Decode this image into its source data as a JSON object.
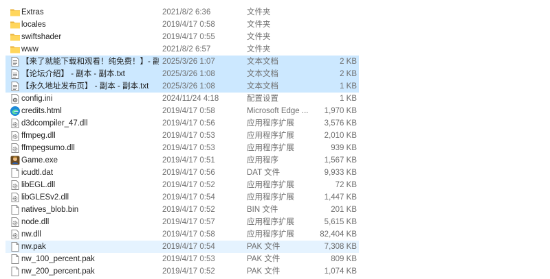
{
  "files": [
    {
      "name": "Extras",
      "date": "2021/8/2 6:36",
      "type": "文件夹",
      "size": "",
      "icon": "folder-icon",
      "state": ""
    },
    {
      "name": "locales",
      "date": "2019/4/17 0:58",
      "type": "文件夹",
      "size": "",
      "icon": "folder-icon",
      "state": ""
    },
    {
      "name": "swiftshader",
      "date": "2019/4/17 0:55",
      "type": "文件夹",
      "size": "",
      "icon": "folder-icon",
      "state": ""
    },
    {
      "name": "www",
      "date": "2021/8/2 6:57",
      "type": "文件夹",
      "size": "",
      "icon": "folder-icon",
      "state": ""
    },
    {
      "name": "【来了就能下载和观看！纯免费！】- 副...",
      "date": "2025/3/26 1:07",
      "type": "文本文档",
      "size": "2 KB",
      "icon": "text-file-icon",
      "state": "selected"
    },
    {
      "name": "【论坛介绍】 - 副本 - 副本.txt",
      "date": "2025/3/26 1:08",
      "type": "文本文档",
      "size": "2 KB",
      "icon": "text-file-icon",
      "state": "selected"
    },
    {
      "name": "【永久地址发布页】 - 副本 - 副本.txt",
      "date": "2025/3/26 1:08",
      "type": "文本文档",
      "size": "1 KB",
      "icon": "text-file-icon",
      "state": "selected"
    },
    {
      "name": "config.ini",
      "date": "2024/11/24 4:18",
      "type": "配置设置",
      "size": "1 KB",
      "icon": "config-file-icon",
      "state": ""
    },
    {
      "name": "credits.html",
      "date": "2019/4/17 0:58",
      "type": "Microsoft Edge ...",
      "size": "1,970 KB",
      "icon": "edge-icon",
      "state": ""
    },
    {
      "name": "d3dcompiler_47.dll",
      "date": "2019/4/17 0:56",
      "type": "应用程序扩展",
      "size": "3,576 KB",
      "icon": "dll-file-icon",
      "state": ""
    },
    {
      "name": "ffmpeg.dll",
      "date": "2019/4/17 0:53",
      "type": "应用程序扩展",
      "size": "2,010 KB",
      "icon": "dll-file-icon",
      "state": ""
    },
    {
      "name": "ffmpegsumo.dll",
      "date": "2019/4/17 0:53",
      "type": "应用程序扩展",
      "size": "939 KB",
      "icon": "dll-file-icon",
      "state": ""
    },
    {
      "name": "Game.exe",
      "date": "2019/4/17 0:51",
      "type": "应用程序",
      "size": "1,567 KB",
      "icon": "game-exe-icon",
      "state": ""
    },
    {
      "name": "icudtl.dat",
      "date": "2019/4/17 0:56",
      "type": "DAT 文件",
      "size": "9,933 KB",
      "icon": "blank-file-icon",
      "state": ""
    },
    {
      "name": "libEGL.dll",
      "date": "2019/4/17 0:52",
      "type": "应用程序扩展",
      "size": "72 KB",
      "icon": "dll-file-icon",
      "state": ""
    },
    {
      "name": "libGLESv2.dll",
      "date": "2019/4/17 0:54",
      "type": "应用程序扩展",
      "size": "1,447 KB",
      "icon": "dll-file-icon",
      "state": ""
    },
    {
      "name": "natives_blob.bin",
      "date": "2019/4/17 0:52",
      "type": "BIN 文件",
      "size": "201 KB",
      "icon": "blank-file-icon",
      "state": ""
    },
    {
      "name": "node.dll",
      "date": "2019/4/17 0:57",
      "type": "应用程序扩展",
      "size": "5,615 KB",
      "icon": "dll-file-icon",
      "state": ""
    },
    {
      "name": "nw.dll",
      "date": "2019/4/17 0:58",
      "type": "应用程序扩展",
      "size": "82,404 KB",
      "icon": "dll-file-icon",
      "state": ""
    },
    {
      "name": "nw.pak",
      "date": "2019/4/17 0:54",
      "type": "PAK 文件",
      "size": "7,308 KB",
      "icon": "blank-file-icon",
      "state": "hover"
    },
    {
      "name": "nw_100_percent.pak",
      "date": "2019/4/17 0:53",
      "type": "PAK 文件",
      "size": "809 KB",
      "icon": "blank-file-icon",
      "state": ""
    },
    {
      "name": "nw_200_percent.pak",
      "date": "2019/4/17 0:52",
      "type": "PAK 文件",
      "size": "1,074 KB",
      "icon": "blank-file-icon",
      "state": ""
    }
  ]
}
